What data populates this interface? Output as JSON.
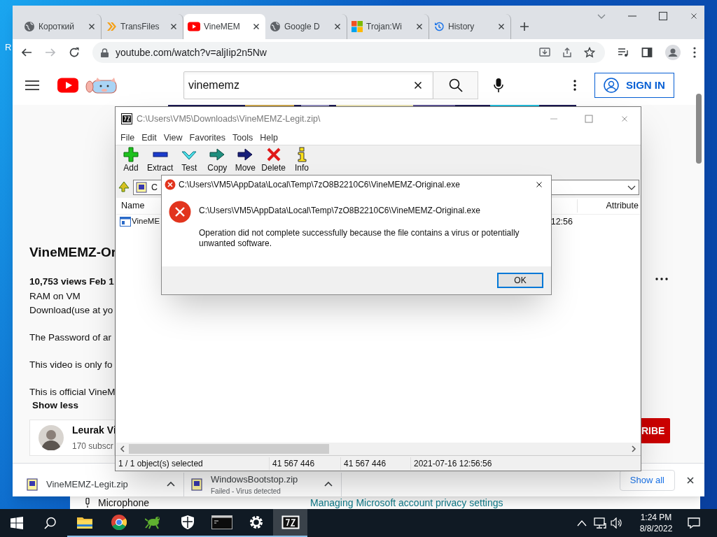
{
  "desktop": {
    "icon_label": "R"
  },
  "browser": {
    "tabs": [
      {
        "kind": "globe",
        "title": "Короткий",
        "selected": false
      },
      {
        "kind": "chevrons",
        "title": "TransFiles",
        "selected": false
      },
      {
        "kind": "youtube",
        "title": "VineMEM",
        "selected": true
      },
      {
        "kind": "globe",
        "title": "Google D",
        "selected": false
      },
      {
        "kind": "windows",
        "title": "Trojan:Wi",
        "selected": false
      },
      {
        "kind": "history",
        "title": "History",
        "selected": false
      }
    ],
    "url": "youtube.com/watch?v=aljIip2n5Nw"
  },
  "youtube": {
    "search_value": "vinememz",
    "sign_in": "SIGN IN",
    "video_title": "VineMEMZ-Or",
    "stats": "10,753 views  Feb 1",
    "description": [
      [
        "RAM on VM",
        "Download(use at yo"
      ],
      [
        "The Password of ar"
      ],
      [
        "This video is only fo"
      ],
      [
        "This is official VineM"
      ]
    ],
    "show_less": "Show less",
    "channel_name": "Leurak Vi",
    "subscribers": "170 subscr",
    "subscribe": "RIBE"
  },
  "downloads": {
    "items": [
      {
        "name": "VineMEMZ-Legit.zip"
      },
      {
        "name": "WindowsBootstop.zip",
        "status": "Failed - Virus detected"
      }
    ],
    "show_all": "Show all"
  },
  "settings_behind": {
    "item": "Microphone",
    "link": "Managing Microsoft account privacy settings"
  },
  "archive_window": {
    "title": "C:\\Users\\VM5\\Downloads\\VineMEMZ-Legit.zip\\",
    "menu": [
      "File",
      "Edit",
      "View",
      "Favorites",
      "Tools",
      "Help"
    ],
    "toolbar": [
      {
        "kind": "add",
        "label": "Add"
      },
      {
        "kind": "extract",
        "label": "Extract"
      },
      {
        "kind": "test",
        "label": "Test"
      },
      {
        "kind": "copy",
        "label": "Copy"
      },
      {
        "kind": "move",
        "label": "Move"
      },
      {
        "kind": "delete",
        "label": "Delete"
      },
      {
        "kind": "info",
        "label": "Info"
      }
    ],
    "address": "C",
    "columns": [
      "Name",
      "Attribute"
    ],
    "rows": [
      {
        "name": "VineME",
        "modified": "12:56"
      }
    ],
    "status": [
      "1 / 1 object(s) selected",
      "41 567 446",
      "41 567 446",
      "2021-07-16 12:56:56"
    ]
  },
  "dialog": {
    "title": "C:\\Users\\VM5\\AppData\\Local\\Temp\\7zO8B2210C6\\VineMEMZ-Original.exe",
    "path": "C:\\Users\\VM5\\AppData\\Local\\Temp\\7zO8B2210C6\\VineMEMZ-Original.exe",
    "message": "Operation did not complete successfully because the file contains a virus or potentially unwanted software.",
    "button": "OK"
  },
  "taskbar": {
    "apps": [
      {
        "kind": "explorer",
        "running": true,
        "selected": false
      },
      {
        "kind": "chrome",
        "running": true,
        "selected": false
      },
      {
        "kind": "gecko",
        "running": true,
        "selected": false
      },
      {
        "kind": "shield",
        "running": true,
        "selected": false
      },
      {
        "kind": "terminal",
        "running": true,
        "selected": false
      },
      {
        "kind": "settings",
        "running": true,
        "selected": false
      },
      {
        "kind": "archiver",
        "running": true,
        "selected": true
      }
    ],
    "time": "1:24 PM",
    "date": "8/8/2022"
  }
}
